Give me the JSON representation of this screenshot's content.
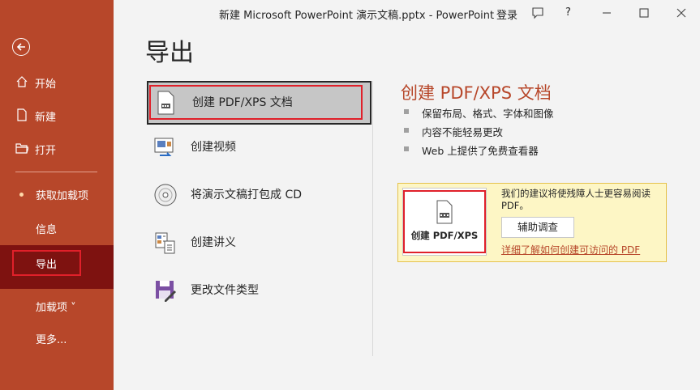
{
  "window": {
    "title": "新建 Microsoft PowerPoint 演示文稿.pptx  -  PowerPoint",
    "login": "登录",
    "help": "?",
    "controls": {
      "feedback": "feedback-icon",
      "minimize": "minimize-icon",
      "maximize": "maximize-icon",
      "close": "close-icon"
    }
  },
  "sidebar": {
    "back": "back-arrow-icon",
    "items": [
      {
        "label": "开始",
        "icon": "home-icon"
      },
      {
        "label": "新建",
        "icon": "new-document-icon"
      },
      {
        "label": "打开",
        "icon": "open-folder-icon"
      },
      {
        "label": "获取加载项"
      },
      {
        "label": "信息"
      },
      {
        "label": "导出"
      },
      {
        "label": "加载项 ˅"
      },
      {
        "label": "更多..."
      }
    ],
    "selected": "导出"
  },
  "main": {
    "title": "导出",
    "options": [
      {
        "label": "创建 PDF/XPS 文档",
        "icon": "pdf-document-icon"
      },
      {
        "label": "创建视频",
        "icon": "video-icon"
      },
      {
        "label": "将演示文稿打包成 CD",
        "icon": "cd-icon"
      },
      {
        "label": "创建讲义",
        "icon": "handouts-icon"
      },
      {
        "label": "更改文件类型",
        "icon": "save-as-icon"
      }
    ],
    "selected_option": "创建 PDF/XPS 文档"
  },
  "detail": {
    "heading": "创建 PDF/XPS 文档",
    "bullets": [
      "保留布局、格式、字体和图像",
      "内容不能轻易更改",
      "Web 上提供了免费查看器"
    ],
    "button_label": "创建 PDF/XPS",
    "note": "我们的建议将使残障人士更容易阅读 PDF。",
    "assist_button": "辅助调查",
    "link": "详细了解如何创建可访问的 PDF"
  },
  "colors": {
    "accent": "#b7472a",
    "selected_nav": "#7e1210",
    "highlight_box": "#e0202a",
    "info_bg": "#fdf6c5"
  }
}
